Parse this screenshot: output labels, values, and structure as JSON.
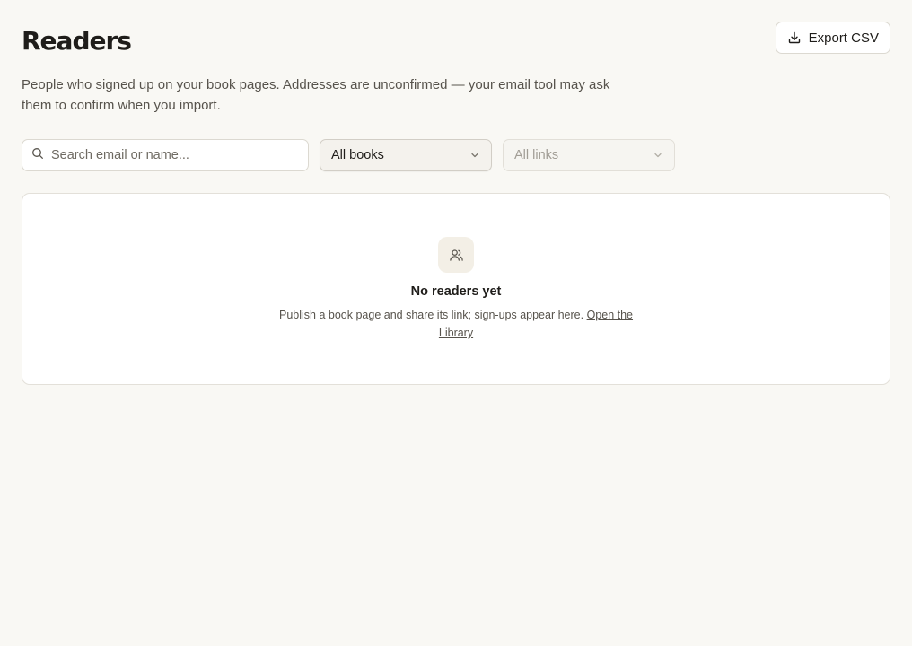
{
  "header": {
    "title": "Readers",
    "subtitle": "People who signed up on your book pages. Addresses are unconfirmed — your email tool may ask them to confirm when you import.",
    "export_label": "Export CSV",
    "export_icon": "download-icon"
  },
  "filters": {
    "search_placeholder": "Search email or name...",
    "search_value": "",
    "search_icon": "search-icon",
    "books_selected": "All books",
    "links_selected": "All links"
  },
  "empty_state": {
    "icon": "users-icon",
    "title": "No readers yet",
    "text": "Publish a book page and share its link; sign-ups appear here.",
    "link_label": "Open the Library"
  },
  "colors": {
    "background": "#f9f8f4",
    "card": "#ffffff",
    "text_primary": "#1f1d1a",
    "text_secondary": "#57534c",
    "text_muted": "#a19d95",
    "border": "#dcd9d1",
    "icon_bg": "#f3efe6"
  }
}
